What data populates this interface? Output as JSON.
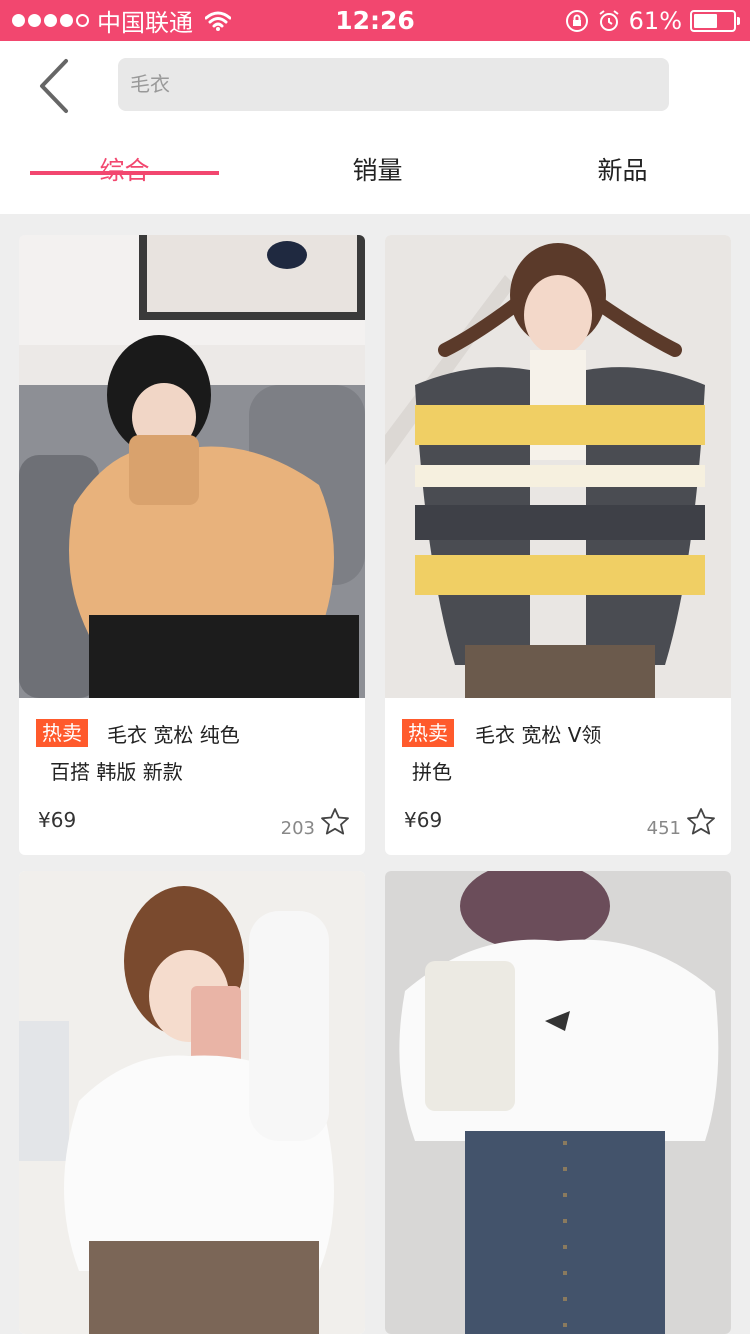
{
  "status_bar": {
    "carrier": "中国联通",
    "time": "12:26",
    "battery_percent": "61%",
    "battery_level": 0.61
  },
  "search": {
    "value": "毛衣"
  },
  "tabs": [
    {
      "label": "综合",
      "active": true
    },
    {
      "label": "销量",
      "active": false
    },
    {
      "label": "新品",
      "active": false
    }
  ],
  "products": [
    {
      "badge": "热卖",
      "title_line1": "毛衣 宽松  纯色",
      "title_line2": "百搭  韩版  新款",
      "price": "¥69",
      "likes": "203"
    },
    {
      "badge": "热卖",
      "title_line1": "毛衣 宽松  V领",
      "title_line2": "拼色",
      "price": "¥69",
      "likes": "451"
    }
  ],
  "colors": {
    "accent": "#f2476f",
    "badge": "#ff5a2c"
  }
}
